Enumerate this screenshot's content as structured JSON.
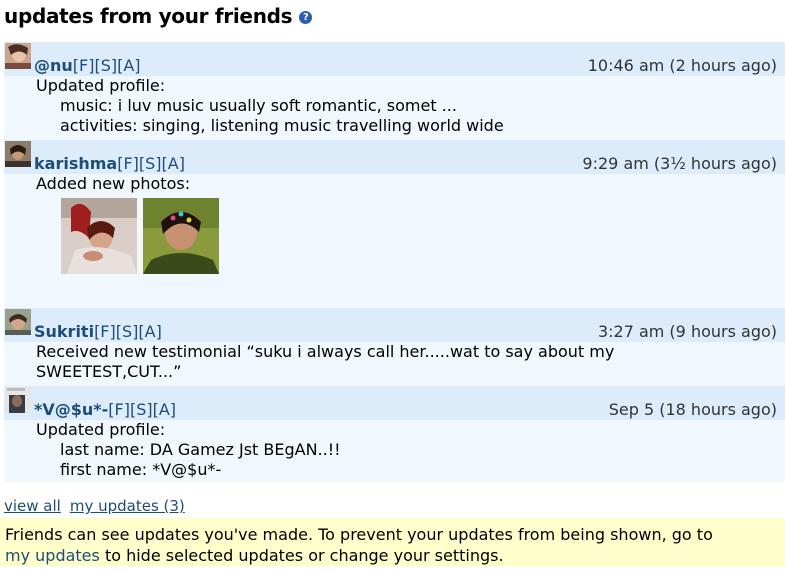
{
  "header": {
    "title": "updates from your friends",
    "help_icon": "?"
  },
  "entries": [
    {
      "name": "@nu",
      "links": [
        "[F]",
        "[S]",
        "[A]"
      ],
      "time": "10:46 am (2 hours ago)",
      "action": "Updated profile:",
      "lines": [
        "music: i luv music usually soft romantic, somet ...",
        "activities: singing, listening music travelling world wide"
      ]
    },
    {
      "name": "karishma",
      "links": [
        "[F]",
        "[S]",
        "[A]"
      ],
      "time": "9:29 am (3½ hours ago)",
      "action": "Added new photos:"
    },
    {
      "name": "Sukriti",
      "links": [
        "[F]",
        "[S]",
        "[A]"
      ],
      "time": "3:27 am (9 hours ago)",
      "action": "Received new testimonial “suku i always call her.....wat to say about my",
      "action2": "SWEETEST,CUT...”"
    },
    {
      "name": "*V@$u*-",
      "links": [
        "[F]",
        "[S]",
        "[A]"
      ],
      "time": "Sep 5 (18 hours ago)",
      "action": "Updated profile:",
      "lines": [
        "last name: DA Gamez Jst BEgAN..!!",
        "first name: *V@$u*-"
      ]
    }
  ],
  "footer_links": {
    "view_all": "view all",
    "my_updates": "my updates (3)"
  },
  "notice": {
    "text1": "Friends can see updates you've made. To prevent your updates from being shown, go to",
    "link": "my updates",
    "text2": " to hide selected updates or change your settings."
  }
}
